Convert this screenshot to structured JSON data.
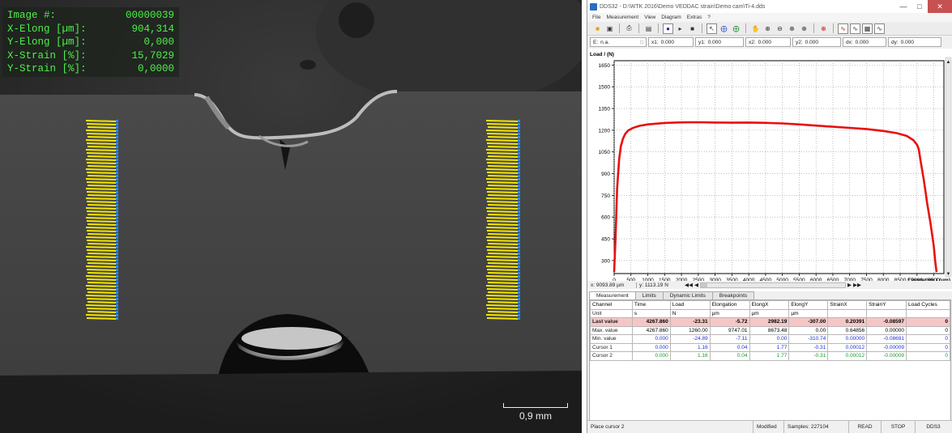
{
  "image_overlay": {
    "rows": [
      {
        "label": "Image #:",
        "value": "00000039"
      },
      {
        "label": "X-Elong [µm]:",
        "value": "904,314"
      },
      {
        "label": "Y-Elong [µm]:",
        "value": "0,000"
      },
      {
        "label": "X-Strain [%]:",
        "value": "15,7029"
      },
      {
        "label": "Y-Strain [%]:",
        "value": "0,0000"
      }
    ],
    "scale_bar": "0,9 mm"
  },
  "window": {
    "title": "DDS32 - D:\\WTK 2016\\Demo VEDDAC strain\\Demo cam\\Ti-4.dds",
    "menu": [
      "File",
      "Measurement",
      "View",
      "Diagram",
      "Extras",
      "?"
    ]
  },
  "cursor_bar": {
    "e_label": "E:",
    "e_value": "n.a.",
    "fields": [
      {
        "label": "x1:",
        "value": "0.000"
      },
      {
        "label": "y1:",
        "value": "0.000"
      },
      {
        "label": "x2:",
        "value": "0.000"
      },
      {
        "label": "y2:",
        "value": "0.000"
      },
      {
        "label": "dx:",
        "value": "0.000"
      },
      {
        "label": "dy:",
        "value": "0.000"
      }
    ]
  },
  "chart_data": {
    "type": "line",
    "ylabel": "Load / (N)",
    "xlabel": "Elongation / (µm)",
    "xlim": [
      0,
      9800
    ],
    "ylim": [
      210,
      1680
    ],
    "x_ticks": [
      0,
      500,
      1000,
      1500,
      2000,
      2500,
      3000,
      3500,
      4000,
      4500,
      5000,
      5500,
      6000,
      6500,
      7000,
      7500,
      8000,
      8500,
      9000,
      9500
    ],
    "y_ticks": [
      300,
      450,
      600,
      750,
      900,
      1050,
      1200,
      1350,
      1500,
      1650
    ],
    "grid": true,
    "series_color": "#e81010",
    "series": [
      {
        "x": [
          0,
          40,
          90,
          150,
          200,
          260,
          330,
          420,
          550,
          750,
          1000,
          1500,
          2000,
          2500,
          3000,
          3500,
          4000,
          4500,
          5000,
          5500,
          6000,
          6500,
          7000,
          7500,
          8000,
          8400,
          8700,
          8900,
          9000,
          9050,
          9100,
          9150,
          9200,
          9250,
          9300,
          9400,
          9500,
          9540,
          9580
        ],
        "y": [
          220,
          450,
          800,
          1000,
          1090,
          1140,
          1175,
          1198,
          1215,
          1230,
          1240,
          1250,
          1254,
          1255,
          1253,
          1252,
          1253,
          1251,
          1247,
          1240,
          1232,
          1224,
          1216,
          1208,
          1195,
          1180,
          1160,
          1130,
          1100,
          1070,
          1000,
          930,
          860,
          780,
          700,
          560,
          400,
          300,
          220
        ]
      }
    ]
  },
  "axis_readout": {
    "x": "x: 9093.89 µm",
    "y": "y: 1113.19 N"
  },
  "tabs": [
    "Measurement",
    "Limits",
    "Dynamic Limits",
    "Breakpoints"
  ],
  "table": {
    "columns": [
      "Channel",
      "Time",
      "Load",
      "Elongation",
      "ElongX",
      "ElongY",
      "StrainX",
      "StrainY",
      "Load Cycles"
    ],
    "rows": [
      [
        "Unit",
        "s",
        "N",
        "µm",
        "µm",
        "µm",
        "",
        "",
        ""
      ],
      [
        "Last value",
        "4267.860",
        "-23.31",
        "-5.72",
        "2982.19",
        "-307.00",
        "0.20391",
        "-0.08597",
        "0"
      ],
      [
        "Max. value",
        "4267.860",
        "1260.00",
        "9747.01",
        "8673.48",
        "0.00",
        "0.64856",
        "0.00000",
        "0"
      ],
      [
        "Min. value",
        "0.000",
        "-24.89",
        "-7.11",
        "0.00",
        "-310.74",
        "0.00000",
        "-0.08691",
        "0"
      ],
      [
        "Cursor 1",
        "0.000",
        "1.16",
        "0.04",
        "1.77",
        "-0.31",
        "0.00012",
        "-0.00009",
        "0"
      ],
      [
        "Cursor 2",
        "0.000",
        "1.16",
        "0.04",
        "1.77",
        "-0.31",
        "0.00012",
        "-0.00009",
        "0"
      ]
    ]
  },
  "status_bar": {
    "hint": "Place cursor 2",
    "modified": "Modified",
    "samples": "Samples: 227104",
    "read": "READ",
    "stop": "STOP",
    "app": "DDS3"
  }
}
